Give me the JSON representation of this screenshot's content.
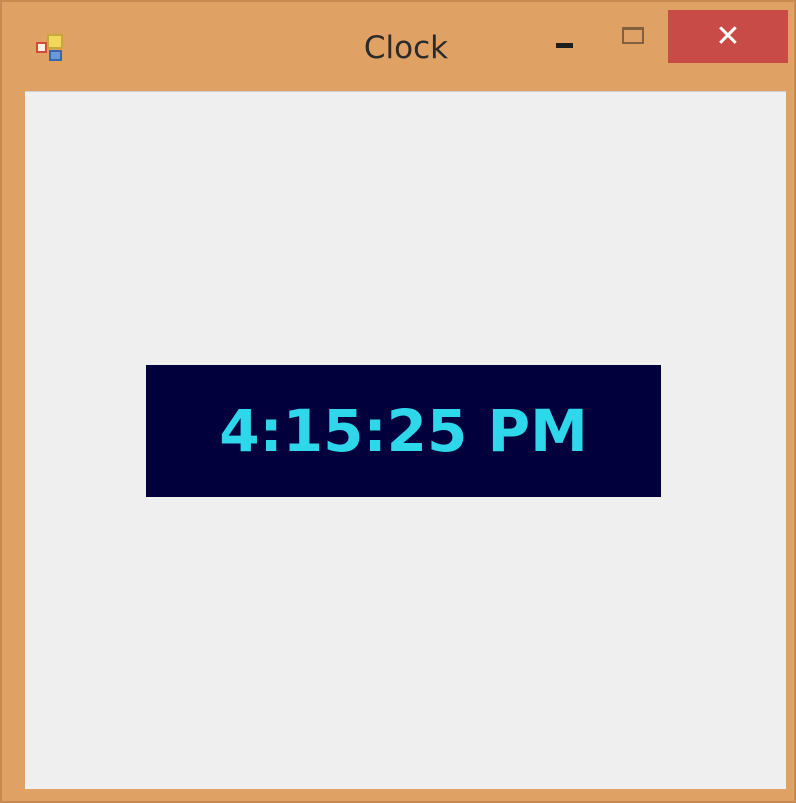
{
  "window": {
    "title": "Clock",
    "app_icon": "windows-forms-app-icon",
    "controls": {
      "minimize_icon": "minimize-icon",
      "maximize_icon": "maximize-icon",
      "close_icon": "close-icon",
      "close_glyph": "✕"
    },
    "colors": {
      "frame": "#e0a165",
      "client_background": "#efefef",
      "close_button": "#c84b47"
    }
  },
  "clock": {
    "time_text": "4:15:25 PM",
    "colors": {
      "background": "#01003d",
      "text": "#2ed7ea"
    }
  }
}
